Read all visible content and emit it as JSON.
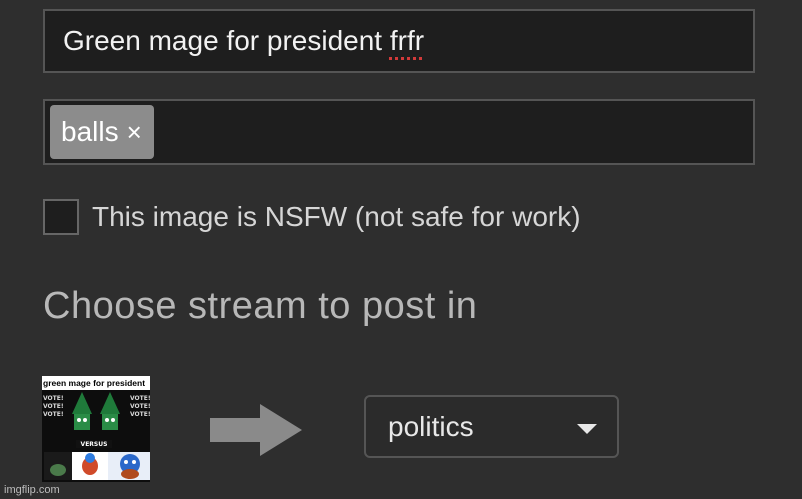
{
  "form": {
    "title_value_main": "Green mage for president ",
    "title_value_misspelled": "frfr",
    "tag_label": "balls",
    "tag_remove_glyph": "×",
    "nsfw_checked": false,
    "nsfw_label": "This image is NSFW (not safe for work)"
  },
  "stream": {
    "heading": "Choose stream to post in",
    "selected": "politics",
    "arrow_icon": "right-arrow-icon",
    "caret_icon": "triangle-down-icon"
  },
  "thumbnail": {
    "title_text": "green mage for president",
    "vote_words": [
      "VOTE!",
      "VOTE!",
      "VOTE!"
    ],
    "versus_text": "VERSUS"
  },
  "watermark": "imgflip.com",
  "colors": {
    "background": "#2e2e2e",
    "input_bg": "#1e1e1e",
    "border": "#555555",
    "chip_bg": "#8c8c8c",
    "spellcheck": "#d23a3a"
  }
}
